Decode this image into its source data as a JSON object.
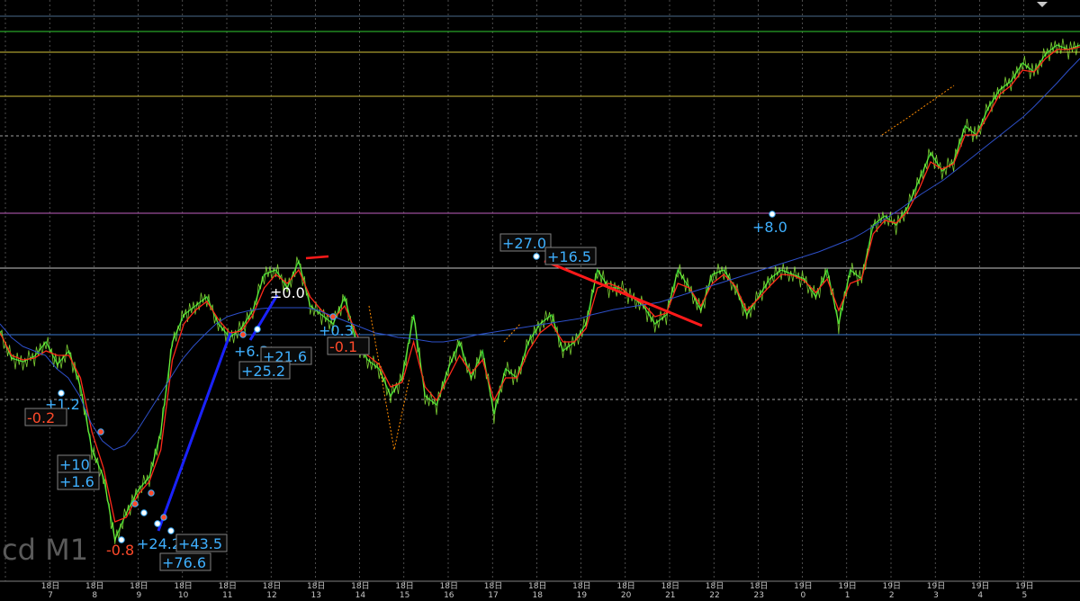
{
  "watermark": "cd M1",
  "colors": {
    "background": "#000000",
    "grid": "#7f7f7f",
    "price": "#32cd32",
    "ma_fast": "#ff2a1a",
    "ma_slow": "#2d4fc8",
    "dotted": "#ff8c00",
    "label_blue": "#3fb0ff",
    "label_red": "#ff4a2a",
    "label_white": "#ffffff",
    "trend_blue": "#1a22ff",
    "trend_red": "#ff1a1a"
  },
  "chart_data": {
    "type": "line",
    "timeframe": "M1",
    "x_tick_labels": [
      {
        "top": "18日",
        "bottom": "7"
      },
      {
        "top": "18日",
        "bottom": "8"
      },
      {
        "top": "18日",
        "bottom": "9"
      },
      {
        "top": "18日",
        "bottom": "10"
      },
      {
        "top": "18日",
        "bottom": "11"
      },
      {
        "top": "18日",
        "bottom": "12"
      },
      {
        "top": "18日",
        "bottom": "13"
      },
      {
        "top": "18日",
        "bottom": "14"
      },
      {
        "top": "18日",
        "bottom": "15"
      },
      {
        "top": "18日",
        "bottom": "16"
      },
      {
        "top": "18日",
        "bottom": "17"
      },
      {
        "top": "18日",
        "bottom": "18"
      },
      {
        "top": "18日",
        "bottom": "19"
      },
      {
        "top": "18日",
        "bottom": "20"
      },
      {
        "top": "18日",
        "bottom": "21"
      },
      {
        "top": "18日",
        "bottom": "22"
      },
      {
        "top": "18日",
        "bottom": "23"
      },
      {
        "top": "19日",
        "bottom": "0"
      },
      {
        "top": "19日",
        "bottom": "1"
      },
      {
        "top": "19日",
        "bottom": "2"
      },
      {
        "top": "19日",
        "bottom": "3"
      },
      {
        "top": "19日",
        "bottom": "4"
      },
      {
        "top": "19日",
        "bottom": "5"
      }
    ],
    "series": [
      {
        "values": [
          368,
          398,
          402,
          396,
          380,
          405,
          390,
          430,
          500,
          530,
          600,
          570,
          545,
          530,
          480,
          380,
          350,
          340,
          330,
          360,
          375,
          365,
          345,
          305,
          300,
          320,
          290,
          340,
          350,
          360,
          330,
          380,
          400,
          410,
          440,
          420,
          350,
          440,
          450,
          410,
          380,
          420,
          390,
          460,
          410,
          420,
          380,
          360,
          350,
          390,
          380,
          360,
          300,
          320,
          320,
          330,
          340,
          360,
          350,
          300,
          320,
          345,
          305,
          300,
          320,
          350,
          330,
          310,
          300,
          305,
          310,
          330,
          300,
          360,
          300,
          310,
          250,
          240,
          250,
          230,
          200,
          170,
          190,
          180,
          140,
          150,
          120,
          100,
          90,
          70,
          80,
          60,
          50,
          55,
          50
        ]
      },
      {
        "values": [
          370,
          395,
          400,
          398,
          390,
          395,
          395,
          420,
          480,
          520,
          580,
          575,
          550,
          535,
          500,
          400,
          360,
          345,
          335,
          355,
          370,
          368,
          350,
          320,
          305,
          315,
          300,
          330,
          345,
          355,
          340,
          370,
          395,
          405,
          430,
          425,
          380,
          430,
          445,
          420,
          395,
          415,
          400,
          445,
          420,
          420,
          390,
          370,
          360,
          380,
          380,
          365,
          320,
          315,
          320,
          330,
          338,
          352,
          348,
          315,
          320,
          340,
          315,
          305,
          318,
          345,
          332,
          318,
          305,
          306,
          312,
          325,
          310,
          345,
          315,
          310,
          260,
          245,
          248,
          235,
          210,
          180,
          188,
          182,
          150,
          150,
          128,
          105,
          95,
          78,
          80,
          65,
          55,
          55,
          52
        ]
      },
      {
        "values": [
          360,
          375,
          385,
          390,
          395,
          410,
          420,
          440,
          470,
          490,
          500,
          495,
          480,
          460,
          440,
          420,
          400,
          385,
          372,
          360,
          352,
          348,
          345,
          343,
          342,
          342,
          342,
          342,
          345,
          350,
          355,
          360,
          365,
          370,
          372,
          375,
          376,
          378,
          380,
          380,
          378,
          375,
          372,
          370,
          368,
          366,
          364,
          362,
          360,
          358,
          356,
          354,
          350,
          347,
          344,
          342,
          340,
          338,
          336,
          332,
          328,
          324,
          320,
          316,
          312,
          308,
          304,
          300,
          296,
          292,
          288,
          284,
          280,
          275,
          270,
          265,
          258,
          250,
          242,
          234,
          225,
          216,
          208,
          200,
          190,
          180,
          170,
          160,
          150,
          140,
          130,
          118,
          105,
          92,
          78,
          65
        ]
      }
    ],
    "horizontal_levels": [
      {
        "style": "solid",
        "color": "#4a6a8a"
      },
      {
        "style": "solid",
        "color": "#32cd32"
      },
      {
        "style": "solid",
        "color": "#d4c23a"
      },
      {
        "style": "solid",
        "color": "#d4c23a"
      },
      {
        "style": "dashed",
        "color": "#a0a0a0"
      },
      {
        "style": "solid",
        "color": "#c060c0"
      },
      {
        "style": "solid",
        "color": "#c8c8c8"
      },
      {
        "style": "solid",
        "color": "#3a7ad0"
      },
      {
        "style": "dashed",
        "color": "#a0a0a0"
      }
    ],
    "annotations": [
      {
        "text": "+1.2",
        "color": "label_blue",
        "boxed": false
      },
      {
        "text": "-0.2",
        "color": "label_red",
        "boxed": true
      },
      {
        "text": "+10",
        "color": "label_blue",
        "boxed": true
      },
      {
        "text": "+1.6",
        "color": "label_blue",
        "boxed": true
      },
      {
        "text": "-0.8",
        "color": "label_red",
        "boxed": false
      },
      {
        "text": "+24.2",
        "color": "label_blue",
        "boxed": false
      },
      {
        "text": "+43.5",
        "color": "label_blue",
        "boxed": true
      },
      {
        "text": "+76.6",
        "color": "label_blue",
        "boxed": true
      },
      {
        "text": "+6.3",
        "color": "label_blue",
        "boxed": false
      },
      {
        "text": "+21.6",
        "color": "label_blue",
        "boxed": true
      },
      {
        "text": "+25.2",
        "color": "label_blue",
        "boxed": true
      },
      {
        "text": "±0.0",
        "color": "label_white",
        "boxed": false
      },
      {
        "text": "+0.3",
        "color": "label_blue",
        "boxed": false
      },
      {
        "text": "-0.1",
        "color": "label_red",
        "boxed": true
      },
      {
        "text": "+27.0",
        "color": "label_blue",
        "boxed": true
      },
      {
        "text": "+16.5",
        "color": "label_blue",
        "boxed": true
      },
      {
        "text": "+8.0",
        "color": "label_blue",
        "boxed": false
      }
    ]
  }
}
